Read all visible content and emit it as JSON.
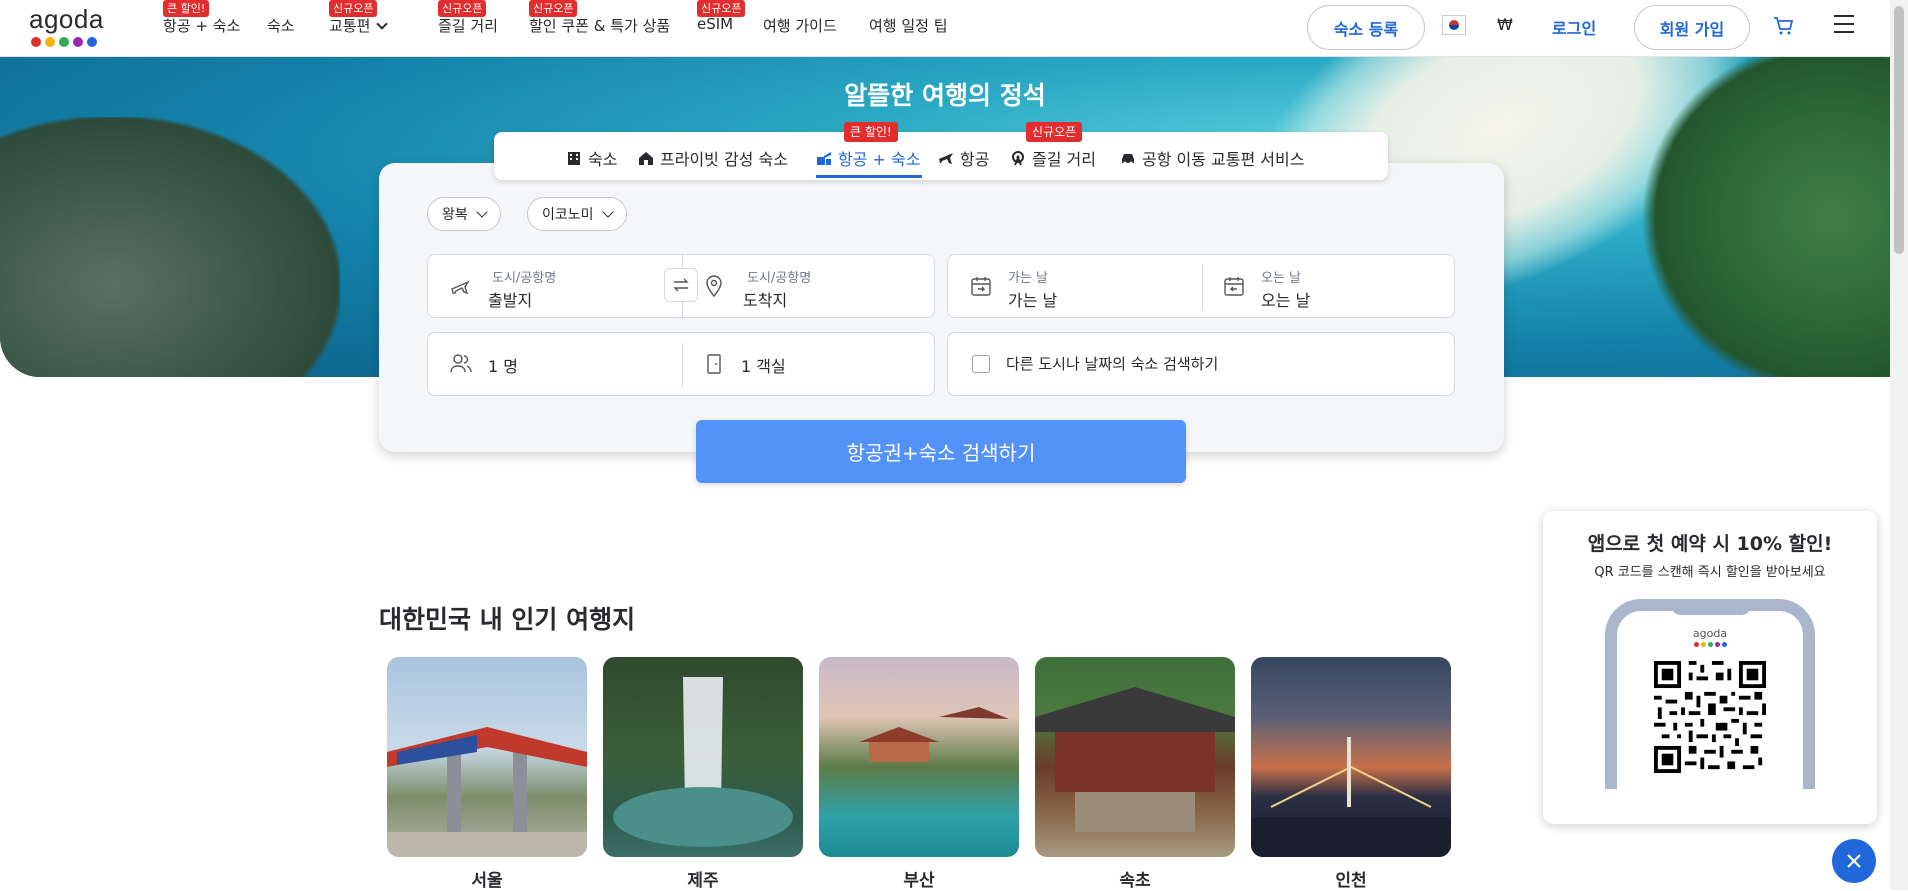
{
  "header": {
    "logo_text": "agoda",
    "logo_dot_colors": [
      "#e12d2d",
      "#f4b400",
      "#34a853",
      "#9b27b0",
      "#2067da"
    ],
    "nav": [
      {
        "label": "항공 + 숙소",
        "badge": "큰 할인!"
      },
      {
        "label": "숙소",
        "badge": ""
      },
      {
        "label": "교통편",
        "badge": "신규오픈",
        "dropdown": true
      },
      {
        "label": "즐길 거리",
        "badge": "신규오픈"
      },
      {
        "label": "할인 쿠폰 & 특가 상품",
        "badge": "신규오픈"
      },
      {
        "label": "eSIM",
        "badge": "신규오픈"
      },
      {
        "label": "여행 가이드",
        "badge": ""
      },
      {
        "label": "여행 일정 팁",
        "badge": ""
      }
    ],
    "list_property_label": "숙소 등록",
    "flag_icon": "korea-flag-icon",
    "currency": "₩",
    "login_label": "로그인",
    "signup_label": "회원 가입",
    "cart_icon": "cart-icon",
    "menu_icon": "hamburger-menu-icon"
  },
  "hero": {
    "title": "알뜰한 여행의 정석"
  },
  "tabs": [
    {
      "label": "숙소",
      "icon": "hotel-icon",
      "active": false,
      "badge": ""
    },
    {
      "label": "프라이빗 감성 숙소",
      "icon": "house-icon",
      "active": false,
      "badge": ""
    },
    {
      "label": "항공 + 숙소",
      "icon": "flight-hotel-icon",
      "active": true,
      "badge": "큰 할인!"
    },
    {
      "label": "항공",
      "icon": "plane-icon",
      "active": false,
      "badge": ""
    },
    {
      "label": "즐길 거리",
      "icon": "ferris-wheel-icon",
      "active": false,
      "badge": "신규오픈"
    },
    {
      "label": "공항 이동 교통편 서비스",
      "icon": "car-icon",
      "active": false,
      "badge": ""
    }
  ],
  "search": {
    "trip_type": "왕복",
    "cabin_class": "이코노미",
    "origin_label": "도시/공항명",
    "origin_value": "출발지",
    "destination_label": "도시/공항명",
    "destination_value": "도착지",
    "depart_label": "가는 날",
    "depart_value": "가는 날",
    "return_label": "오는 날",
    "return_value": "오는 날",
    "guests": "1 명",
    "rooms": "1 객실",
    "other_city_checkbox": "다른 도시나 날짜의 숙소 검색하기",
    "other_city_checked": false,
    "search_button": "항공권+숙소 검색하기",
    "accent_color": "#5392f9"
  },
  "popular": {
    "title": "대한민국 내 인기 여행지",
    "destinations": [
      {
        "name": "서울"
      },
      {
        "name": "제주"
      },
      {
        "name": "부산"
      },
      {
        "name": "속초"
      },
      {
        "name": "인천"
      }
    ]
  },
  "app_popup": {
    "title": "앱으로 첫 예약 시 10% 할인!",
    "subtitle": "QR 코드를 스캔해 즉시 할인을 받아보세요",
    "phone_logo": "agoda",
    "close_icon": "close-icon"
  }
}
